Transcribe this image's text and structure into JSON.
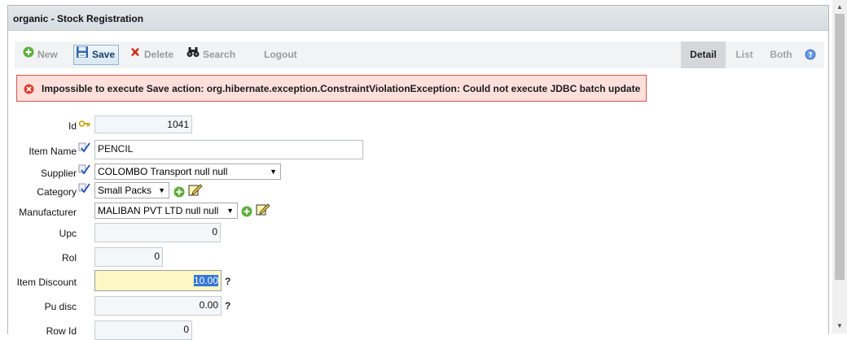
{
  "window": {
    "title": "organic - Stock Registration"
  },
  "toolbar": {
    "new_label": "New",
    "save_label": "Save",
    "delete_label": "Delete",
    "search_label": "Search",
    "logout_label": "Logout",
    "views": {
      "detail": "Detail",
      "list": "List",
      "both": "Both"
    },
    "active_view": "Detail"
  },
  "error": {
    "message": "Impossible to execute Save action: org.hibernate.exception.ConstraintViolationException: Could not execute JDBC batch update",
    "color": "#d9534f"
  },
  "form": {
    "id": {
      "label": "Id",
      "value": "1041"
    },
    "item_name": {
      "label": "Item Name",
      "value": "PENCIL"
    },
    "supplier": {
      "label": "Supplier",
      "value": "COLOMBO Transport null null"
    },
    "category": {
      "label": "Category",
      "value": "Small Packs"
    },
    "manufacturer": {
      "label": "Manufacturer",
      "value": "MALIBAN PVT LTD null null"
    },
    "upc": {
      "label": "Upc",
      "value": "0"
    },
    "rol": {
      "label": "Rol",
      "value": "0"
    },
    "item_discount": {
      "label": "Item Discount",
      "value": "10.00"
    },
    "pu_disc": {
      "label": "Pu disc",
      "value": "0.00"
    },
    "row_id": {
      "label": "Row Id",
      "value": "0"
    }
  },
  "icons": {
    "key": "key-icon",
    "required": "required-check-icon",
    "add": "add-icon",
    "edit": "edit-icon",
    "help": "question-mark"
  },
  "help_mark": "?"
}
